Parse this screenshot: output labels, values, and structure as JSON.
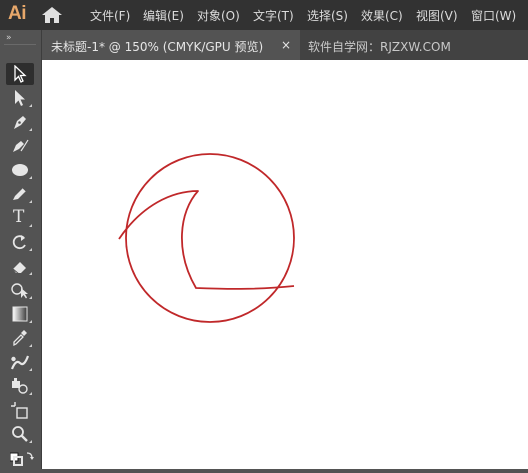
{
  "app": {
    "logo": "Ai"
  },
  "menu": [
    {
      "id": "file",
      "label": "文件(F)"
    },
    {
      "id": "edit",
      "label": "编辑(E)"
    },
    {
      "id": "object",
      "label": "对象(O)"
    },
    {
      "id": "type",
      "label": "文字(T)"
    },
    {
      "id": "select",
      "label": "选择(S)"
    },
    {
      "id": "effect",
      "label": "效果(C)"
    },
    {
      "id": "view",
      "label": "视图(V)"
    },
    {
      "id": "window",
      "label": "窗口(W)"
    }
  ],
  "tabs": {
    "active_title": "未标题-1* @ 150% (CMYK/GPU 预览)",
    "close_symbol": "×",
    "inactive_title": "软件自学网：RJZXW.COM"
  },
  "toolbar": {
    "grip": "»",
    "tools": [
      {
        "name": "selection-tool",
        "icon": "selection-arrow-icon",
        "active": true
      },
      {
        "name": "direct-selection-tool",
        "icon": "direct-selection-icon"
      },
      {
        "name": "pen-tool",
        "icon": "pen-icon"
      },
      {
        "name": "curvature-tool",
        "icon": "curvature-icon"
      },
      {
        "name": "ellipse-tool",
        "icon": "ellipse-icon"
      },
      {
        "name": "pencil-tool",
        "icon": "pencil-icon"
      },
      {
        "name": "type-tool",
        "icon": "type-icon",
        "glyph": "T"
      },
      {
        "name": "rotate-tool",
        "icon": "rotate-icon"
      },
      {
        "name": "eraser-tool",
        "icon": "eraser-icon"
      },
      {
        "name": "shape-builder-tool",
        "icon": "shape-builder-icon"
      },
      {
        "name": "gradient-tool",
        "icon": "gradient-icon"
      },
      {
        "name": "eyedropper-tool",
        "icon": "eyedropper-icon"
      },
      {
        "name": "blend-tool",
        "icon": "blend-icon"
      },
      {
        "name": "symbol-sprayer-tool",
        "icon": "symbol-sprayer-icon"
      },
      {
        "name": "artboard-tool",
        "icon": "artboard-icon"
      },
      {
        "name": "zoom-tool",
        "icon": "zoom-icon"
      },
      {
        "name": "fill-stroke-swap",
        "icon": "fill-stroke-icon"
      }
    ]
  },
  "artwork": {
    "stroke_color": "#c0282a"
  },
  "colors": {
    "menubar_bg": "#323232",
    "panel_bg": "#535353",
    "tabbar_bg": "#424242",
    "canvas_bg": "#ffffff",
    "logo_color": "#e8a86b"
  }
}
